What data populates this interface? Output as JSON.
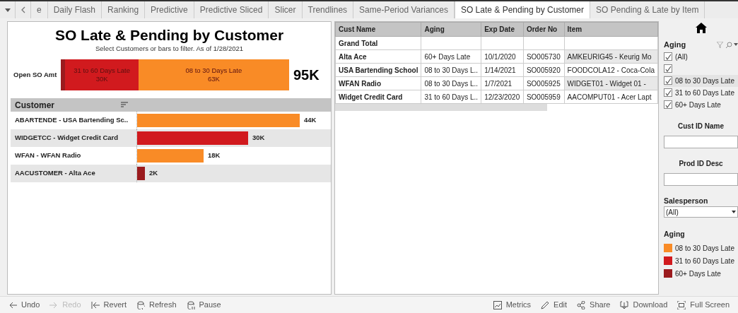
{
  "tabs": [
    {
      "label": "e",
      "selected": false
    },
    {
      "label": "Daily Flash",
      "selected": false
    },
    {
      "label": "Ranking",
      "selected": false
    },
    {
      "label": "Predictive",
      "selected": false
    },
    {
      "label": "Predictive Sliced",
      "selected": false
    },
    {
      "label": "Slicer",
      "selected": false
    },
    {
      "label": "Trendlines",
      "selected": false
    },
    {
      "label": "Same-Period Variances",
      "selected": false
    },
    {
      "label": "SO Late & Pending by Customer",
      "selected": true
    },
    {
      "label": "SO Pending & Late by Item",
      "selected": false
    }
  ],
  "dashboard": {
    "title": "SO Late & Pending by Customer",
    "subtitle": "Select Customers or bars to filter. As of 1/28/2021",
    "total_bar": {
      "label": "Open SO Amt",
      "total": "95K",
      "segments": [
        {
          "color": "#9b1b1e",
          "level": 0.02
        },
        {
          "label": "31 to 60 Days Late",
          "amount": "30K",
          "color": "#d11a1e",
          "level": 0.32
        },
        {
          "label": "08 to 30 Days Late",
          "amount": "63K",
          "color": "#f98b26",
          "level": 0.66
        }
      ]
    },
    "customer_header": "Customer",
    "customers": [
      {
        "name": "ABARTENDE - USA Bartending Sc..",
        "amount": "44K",
        "color": "#f98b26",
        "level": 0.98
      },
      {
        "name": "WIDGETCC - Widget Credit Card",
        "amount": "30K",
        "color": "#d11a1e",
        "level": 0.67
      },
      {
        "name": "WFAN - WFAN Radio",
        "amount": "18K",
        "color": "#f98b26",
        "level": 0.4
      },
      {
        "name": "AACUSTOMER - Alta Ace",
        "amount": "2K",
        "color": "#9b1b1e",
        "level": 0.045
      }
    ]
  },
  "table": {
    "columns": [
      "Cust Name",
      "Aging",
      "Exp Date",
      "Order No",
      "Item"
    ],
    "rows": [
      {
        "cells": [
          "Grand Total",
          "",
          "",
          "",
          ""
        ],
        "highlight": false
      },
      {
        "cells": [
          "Alta Ace",
          "60+ Days Late",
          "10/1/2020",
          "SO005730",
          "AMKEURIG45 - Keurig Mo"
        ],
        "highlight": true
      },
      {
        "cells": [
          "USA Bartending School",
          "08 to 30 Days L..",
          "1/14/2021",
          "SO005920",
          "FOODCOLA12 - Coca-Cola"
        ],
        "highlight": false
      },
      {
        "cells": [
          "WFAN Radio",
          "08 to 30 Days L..",
          "1/7/2021",
          "SO005925",
          "WIDGET01 - Widget 01 -"
        ],
        "highlight": true
      },
      {
        "cells": [
          "Widget Credit Card",
          "31 to 60 Days L..",
          "12/23/2020",
          "SO005959",
          "AACOMPUT01 - Acer Lapt"
        ],
        "highlight": false
      }
    ]
  },
  "filters": {
    "aging": {
      "title": "Aging",
      "options": [
        {
          "label": "(All)",
          "checked": true,
          "selected": false
        },
        {
          "checked": true,
          "selected": false
        },
        {
          "label": "08 to 30 Days Late",
          "checked": true,
          "selected": true
        },
        {
          "label": "31 to 60 Days Late",
          "checked": true,
          "selected": false
        },
        {
          "label": "60+ Days Late",
          "checked": true,
          "selected": false
        }
      ]
    },
    "cust_id": {
      "label": "Cust ID Name"
    },
    "prod_id": {
      "label": "Prod ID Desc"
    },
    "salesperson": {
      "label": "Salesperson",
      "value": "(All)"
    },
    "legend": {
      "title": "Aging",
      "items": [
        {
          "label": "08 to 30 Days Late",
          "color": "#f98b26"
        },
        {
          "label": "31 to 60 Days Late",
          "color": "#d11a1e"
        },
        {
          "label": "60+ Days Late",
          "color": "#9b1b1e"
        }
      ]
    }
  },
  "toolbar": {
    "left": [
      {
        "label": "Undo",
        "kind": "undo",
        "disabled": false
      },
      {
        "label": "Redo",
        "kind": "redo",
        "disabled": true
      },
      {
        "label": "Revert",
        "kind": "revert",
        "disabled": false
      },
      {
        "label": "Refresh",
        "kind": "refresh",
        "disabled": false
      },
      {
        "label": "Pause",
        "kind": "pause",
        "disabled": false
      }
    ],
    "right": [
      {
        "label": "Metrics",
        "kind": "metrics",
        "disabled": false
      },
      {
        "label": "Edit",
        "kind": "edit",
        "disabled": false
      },
      {
        "label": "Share",
        "kind": "share",
        "disabled": false
      },
      {
        "label": "Download",
        "kind": "download",
        "disabled": false
      },
      {
        "label": "Full Screen",
        "kind": "fullscreen",
        "disabled": false
      }
    ]
  }
}
